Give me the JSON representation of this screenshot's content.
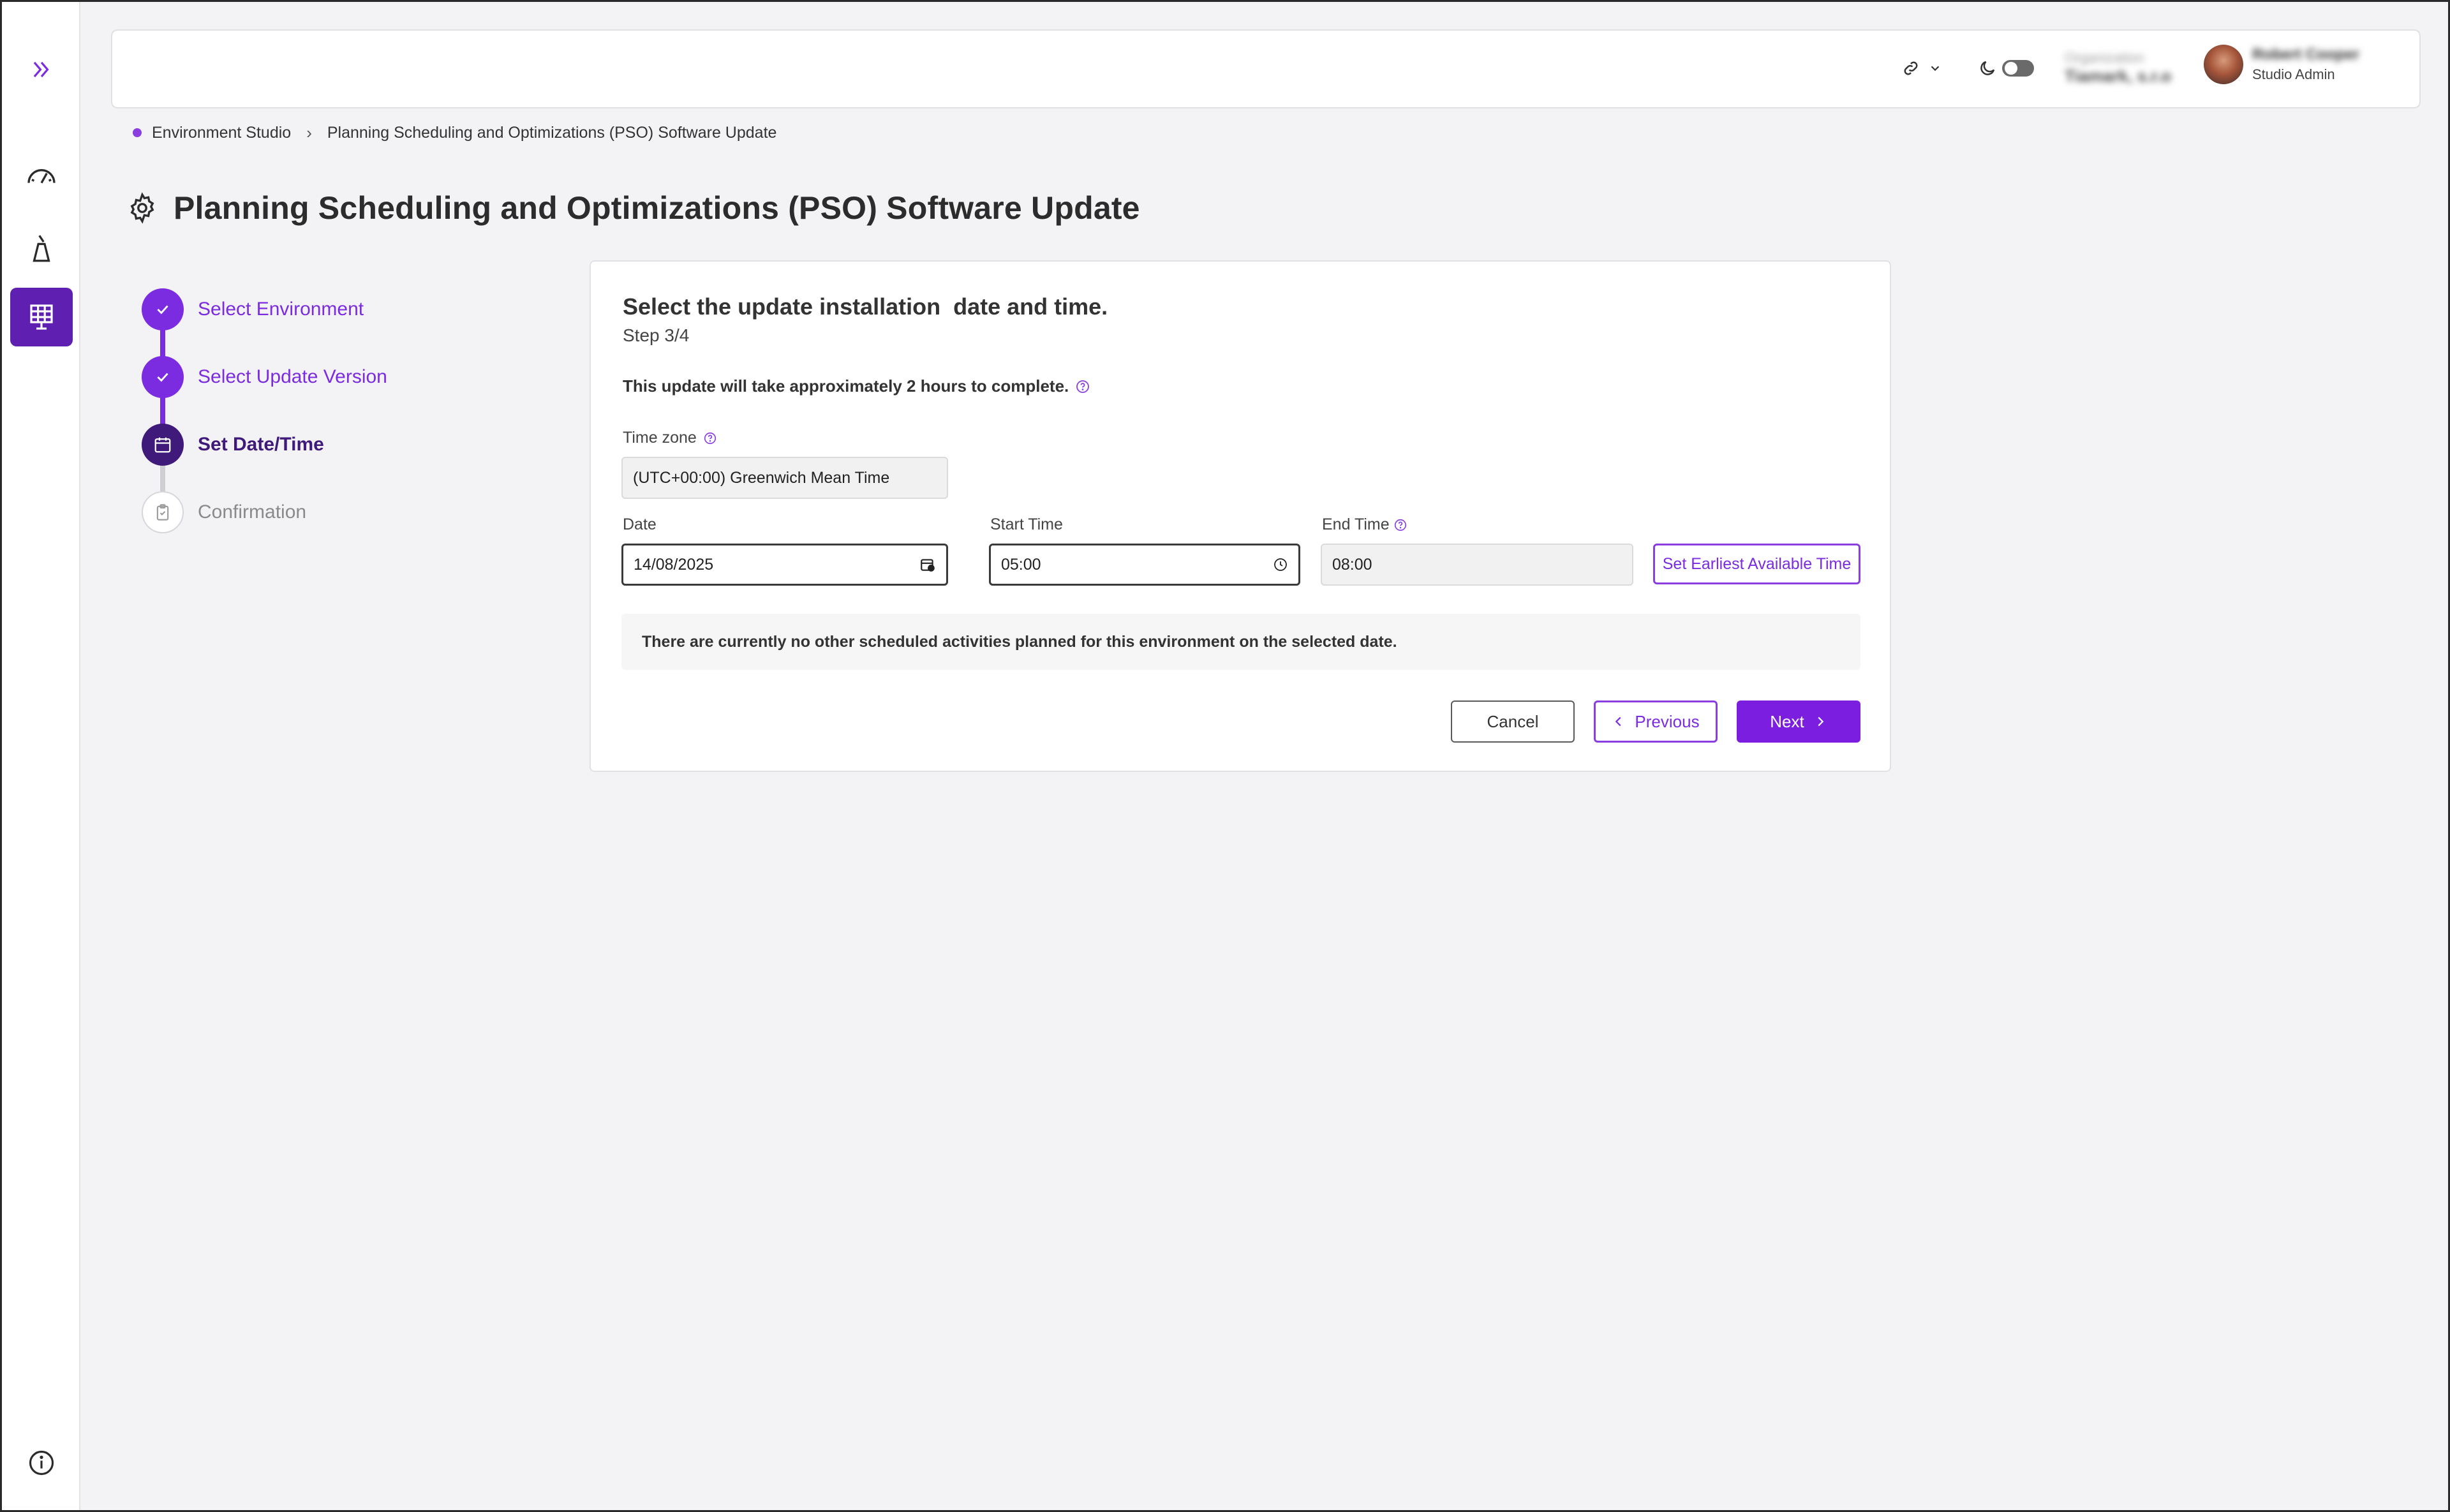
{
  "colors": {
    "accent": "#7b2be0",
    "accent_dark": "#3f1a7a",
    "sidebar_active": "#5f1fb0",
    "background": "#f3f2f4"
  },
  "sidebar": {
    "items": [
      {
        "icon": "expand-chevrons-icon"
      },
      {
        "icon": "dashboard-gauge-icon"
      },
      {
        "icon": "flask-icon"
      },
      {
        "icon": "building-grid-icon",
        "active": true
      },
      {
        "icon": "info-icon"
      }
    ]
  },
  "header": {
    "link_icon": "link-icon",
    "theme_icon": "moon-icon",
    "org_label": "Organization",
    "org_value": "Tiamark, s.r.o",
    "user_name": "Robert Cooper",
    "user_role": "Studio Admin"
  },
  "breadcrumb": {
    "items": [
      "Environment Studio",
      "Planning Scheduling and Optimizations (PSO) Software Update"
    ]
  },
  "page": {
    "title": "Planning Scheduling and Optimizations (PSO) Software Update",
    "title_icon": "gear-icon"
  },
  "stepper": {
    "steps": [
      {
        "label": "Select Environment",
        "status": "done"
      },
      {
        "label": "Select Update Version",
        "status": "done"
      },
      {
        "label": "Set Date/Time",
        "status": "current"
      },
      {
        "label": "Confirmation",
        "status": "pending"
      }
    ]
  },
  "form": {
    "title": "Select the update installation  date and time.",
    "step": "Step 3/4",
    "note": "This update will take approximately 2 hours to complete.",
    "timezone_label": "Time zone",
    "timezone_value": "(UTC+00:00) Greenwich Mean Time",
    "date_label": "Date",
    "date_value": "14/08/2025",
    "start_label": "Start Time",
    "start_value": "05:00",
    "end_label": "End Time",
    "end_value": "08:00",
    "earliest_button": "Set Earliest Available Time",
    "info_message": "There are currently no other scheduled activities planned for this environment on the selected date.",
    "cancel": "Cancel",
    "previous": "Previous",
    "next": "Next"
  }
}
